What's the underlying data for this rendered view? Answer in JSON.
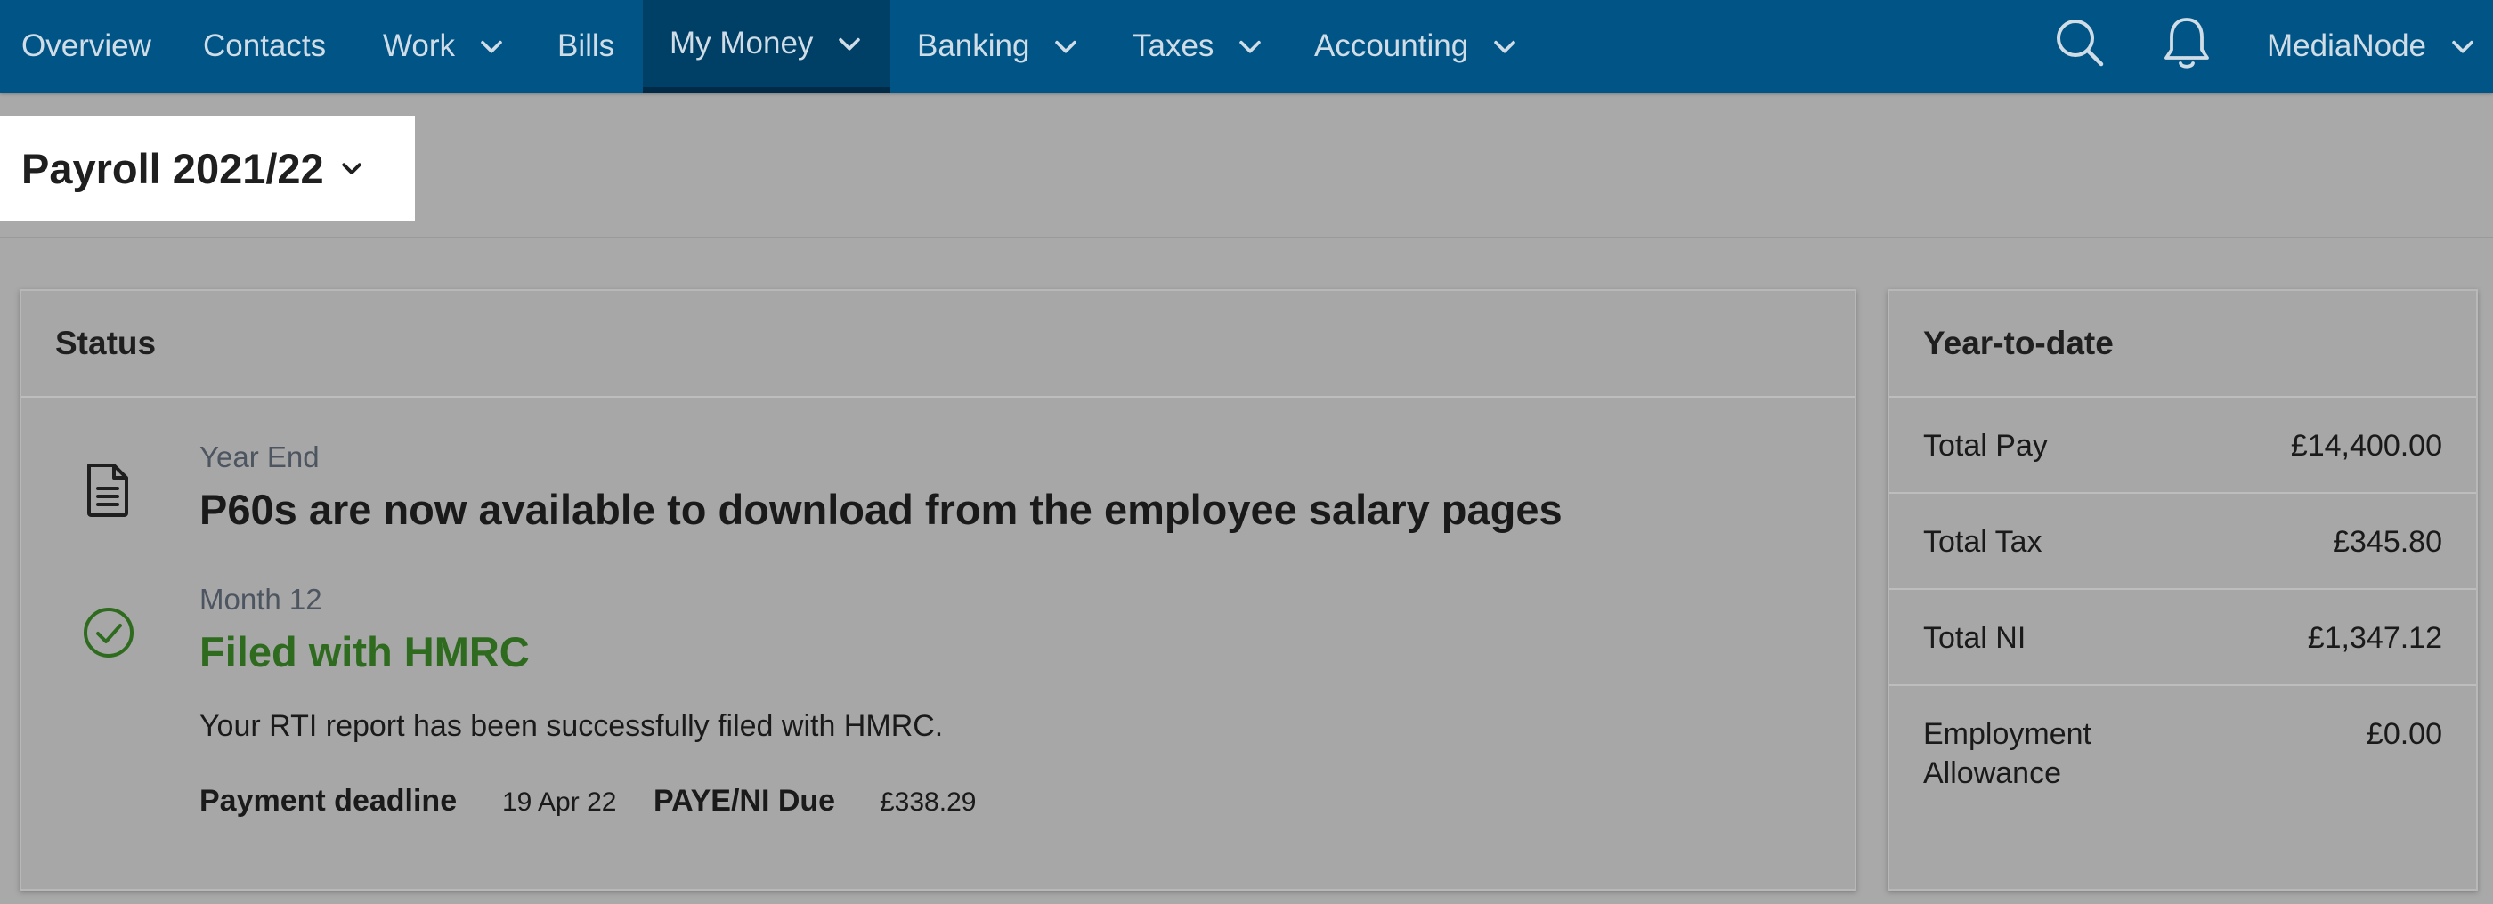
{
  "nav": {
    "items": [
      {
        "label": "Overview"
      },
      {
        "label": "Contacts"
      },
      {
        "label": "Work"
      },
      {
        "label": "Bills"
      },
      {
        "label": "My Money",
        "active": true
      },
      {
        "label": "Banking"
      },
      {
        "label": "Taxes"
      },
      {
        "label": "Accounting"
      }
    ],
    "account_label": "MediaNode",
    "icons": [
      "search-icon",
      "bell-icon",
      "chevron-down-icon"
    ]
  },
  "header": {
    "payroll_select": "Payroll 2021/22"
  },
  "status": {
    "title": "Status",
    "year_end": {
      "label": "Year End",
      "heading": "P60s are now available to download from the employee salary pages"
    },
    "month": {
      "label": "Month 12",
      "heading": "Filed with HMRC",
      "body": "Your RTI report has been successfully filed with HMRC.",
      "payment_deadline_label": "Payment deadline",
      "payment_deadline_value": "19 Apr 22",
      "paye_label": "PAYE/NI Due",
      "paye_value": "£338.29"
    }
  },
  "ytd": {
    "title": "Year-to-date",
    "rows": [
      {
        "label": "Total Pay",
        "value": "£14,400.00"
      },
      {
        "label": "Total Tax",
        "value": "£345.80"
      },
      {
        "label": "Total NI",
        "value": "£1,347.12"
      },
      {
        "label": "Employment Allowance",
        "value": "£0.00"
      }
    ]
  },
  "colors": {
    "nav_bg": "#005486",
    "nav_active": "#003f66",
    "success_green": "#2f6b1f",
    "overlay_bg": "#a9a9a9"
  }
}
